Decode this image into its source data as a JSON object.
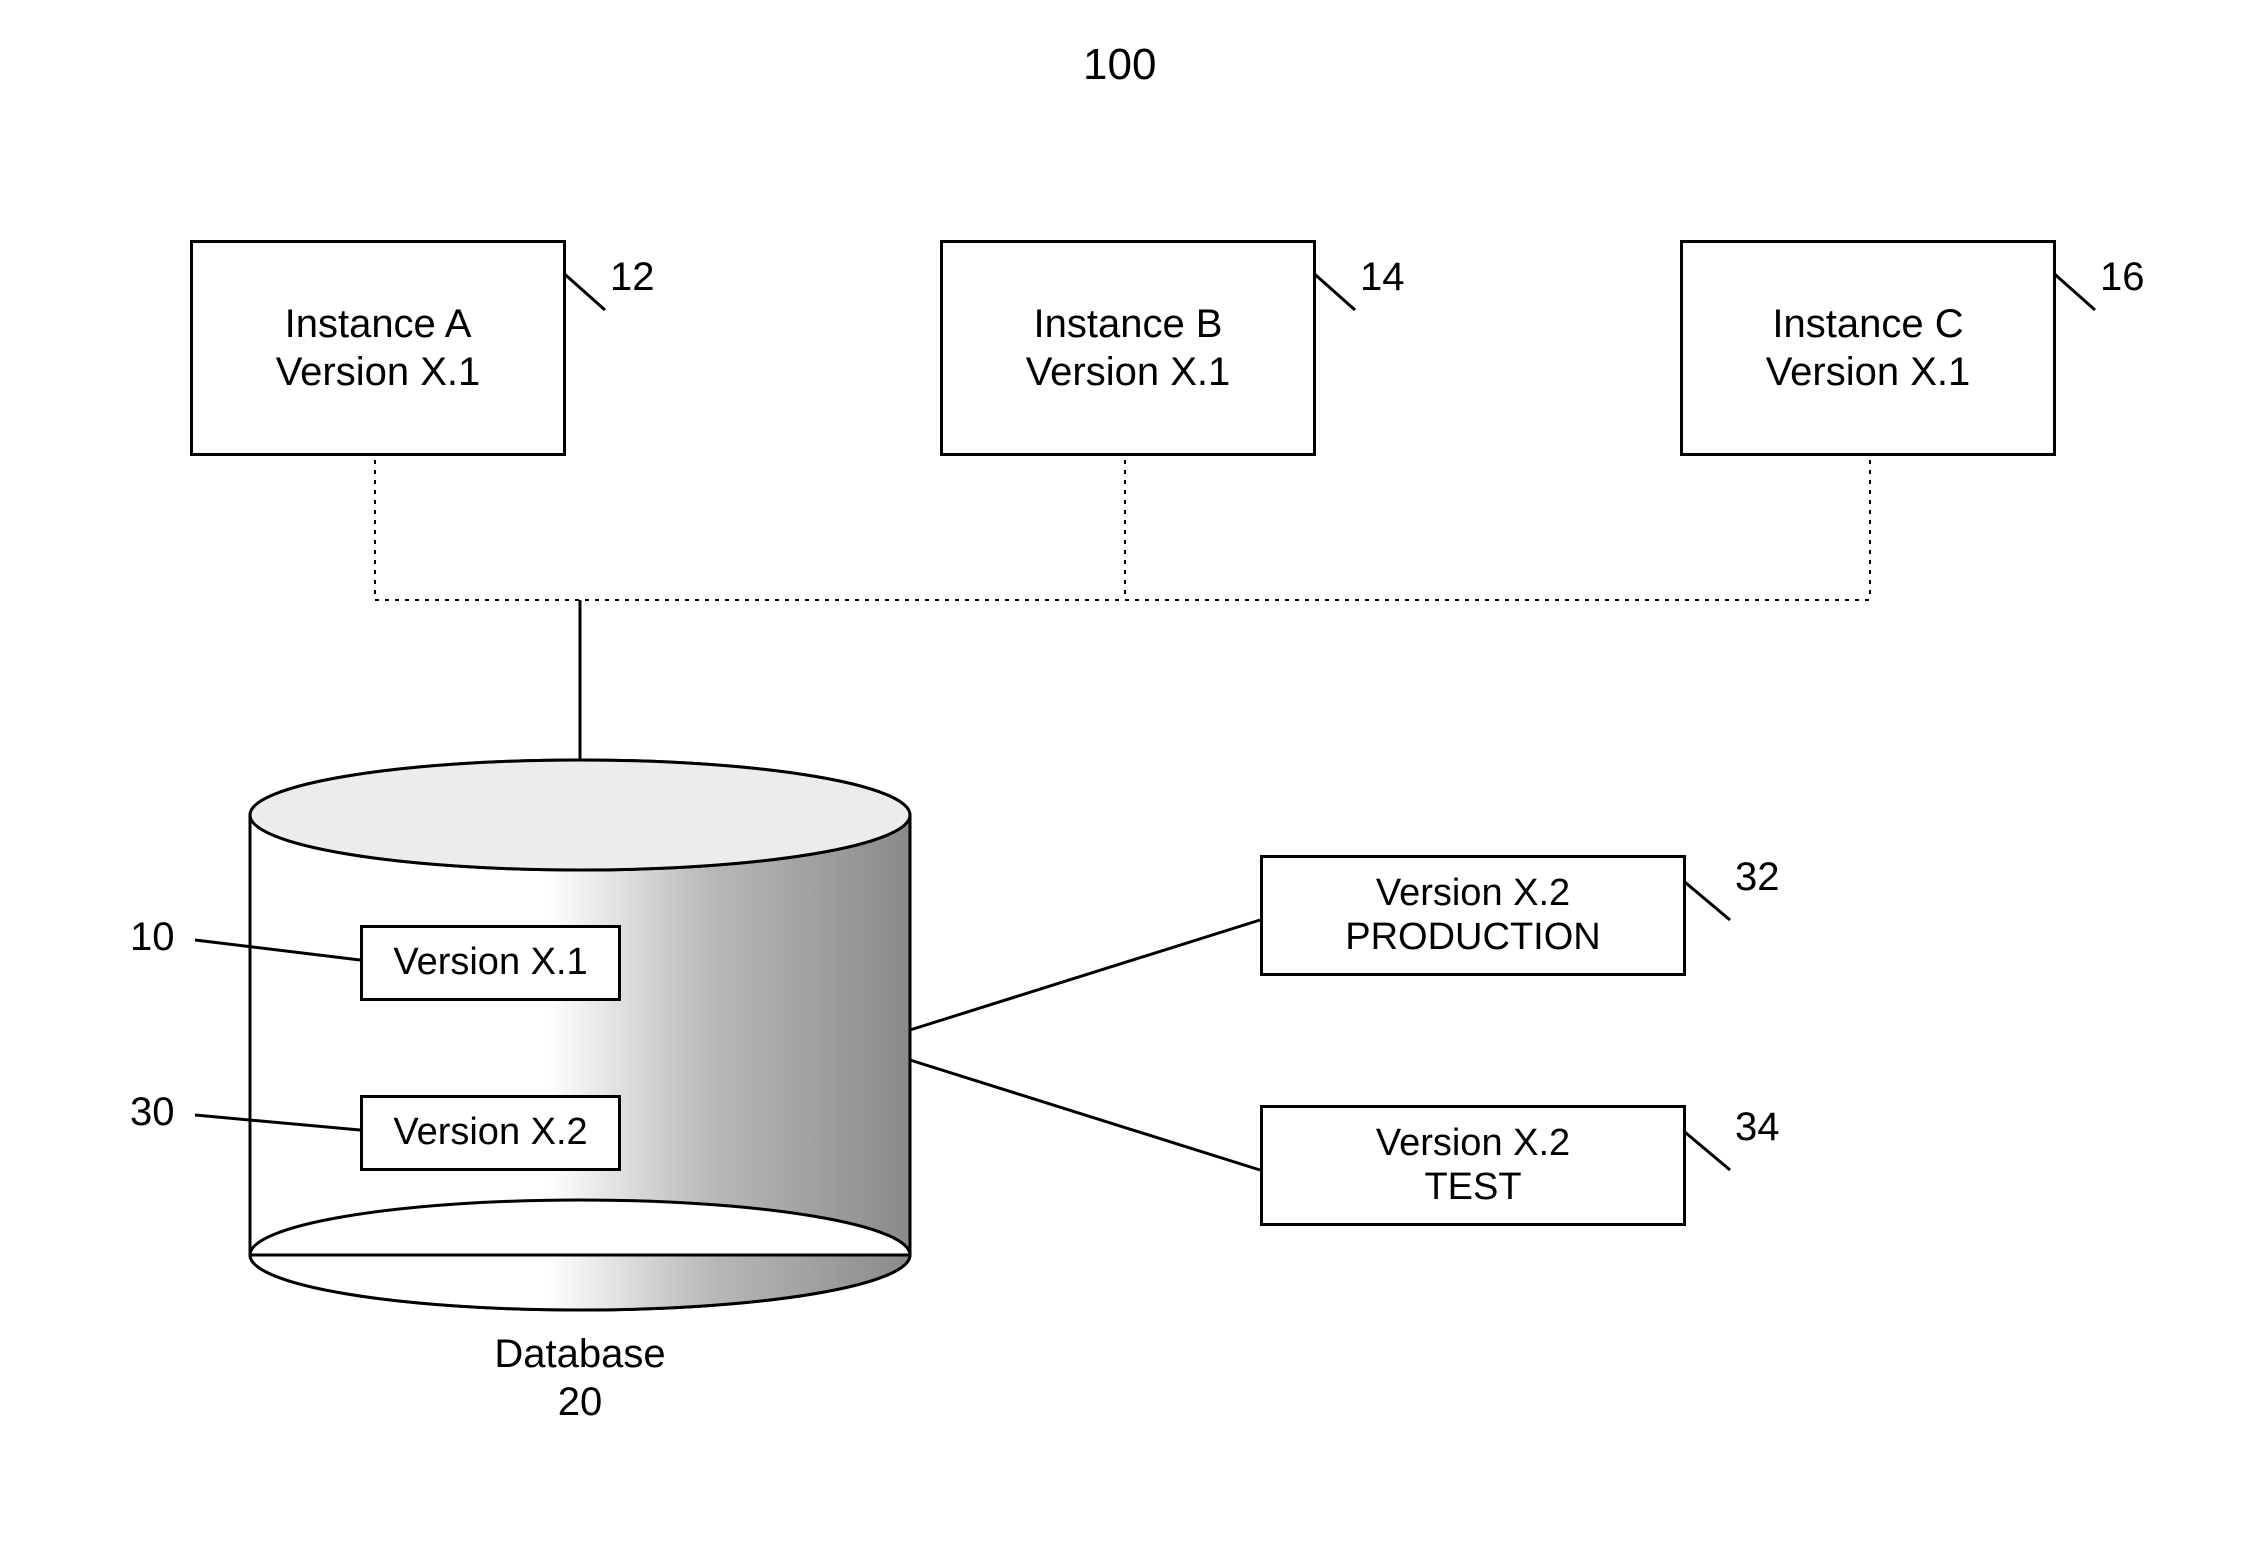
{
  "figure_number": "100",
  "instances": {
    "a": {
      "line1": "Instance A",
      "line2": "Version X.1",
      "ref": "12"
    },
    "b": {
      "line1": "Instance B",
      "line2": "Version X.1",
      "ref": "14"
    },
    "c": {
      "line1": "Instance C",
      "line2": "Version X.1",
      "ref": "16"
    }
  },
  "database": {
    "caption_line1": "Database",
    "caption_line2": "20",
    "version1": {
      "label": "Version X.1",
      "ref": "10"
    },
    "version2": {
      "label": "Version X.2",
      "ref": "30"
    }
  },
  "outputs": {
    "prod": {
      "line1": "Version X.2",
      "line2": "PRODUCTION",
      "ref": "32"
    },
    "test": {
      "line1": "Version X.2",
      "line2": "TEST",
      "ref": "34"
    }
  }
}
